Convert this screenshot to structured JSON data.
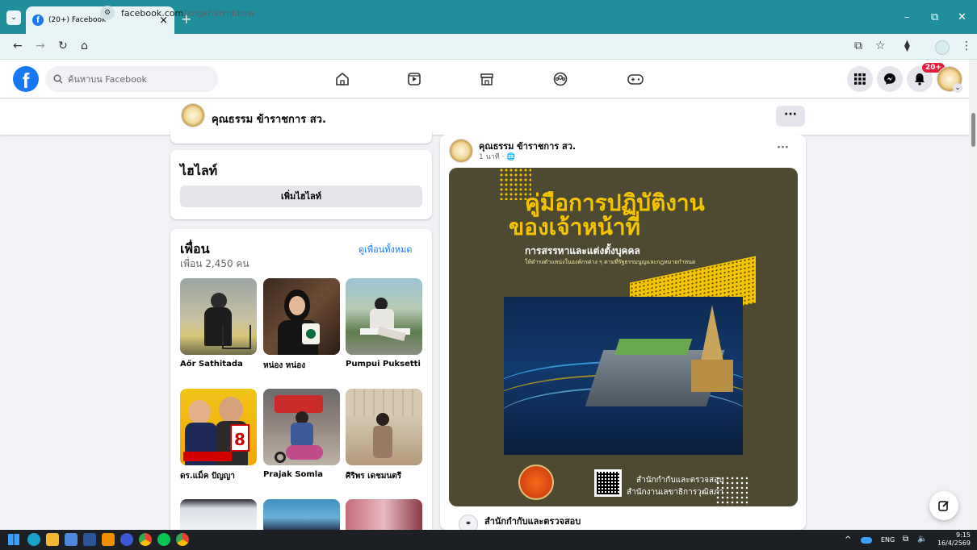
{
  "browser": {
    "tab_title": "(20+) Facebook",
    "close_tab": "×",
    "new_tab": "+",
    "url_host": "facebook.com",
    "url_path": "/xngkhkrtnbbsw",
    "window_minimize": "–",
    "window_restore": "⧉",
    "window_close": "✕"
  },
  "facebook": {
    "logo": "f",
    "search_placeholder": "ค้นหาบน Facebook",
    "notification_count": "20+"
  },
  "page_header": {
    "name": "คุณธรรม ข้าราชการ สว.",
    "more": "···"
  },
  "highlights": {
    "title": "ไฮไลท์",
    "add_button": "เพิ่มไฮไลท์"
  },
  "friends": {
    "title": "เพื่อน",
    "see_all": "ดูเพื่อนทั้งหมด",
    "count": "เพื่อน 2,450 คน",
    "items": [
      {
        "name": "Aőr Sathitada"
      },
      {
        "name": "หน่อง หน่อง"
      },
      {
        "name": "Pumpui Puksetti"
      },
      {
        "name": "ดร.แม็ค ปัญญา"
      },
      {
        "name": "Prajak Somla"
      },
      {
        "name": "ศิริพร เดชมนตรี"
      }
    ]
  },
  "post": {
    "author": "คุณธรรม ข้าราชการ สว.",
    "time": "1 นาที · 🌐",
    "more": "···",
    "image": {
      "title_line1": "คู่มือการปฏิบัติงาน",
      "title_line2": "ของเจ้าหน้าที่",
      "subtitle": "การสรรหาและแต่งตั้งบุคคล",
      "caption": "ให้ดำรงตำแหน่งในองค์กรต่าง ๆ ตามที่รัฐธรรมนูญและกฎหมายกำหนด",
      "org_line1": "สำนักกำกับและตรวจสอบ",
      "org_line2": "สำนักงานเลขาธิการวุฒิสภา"
    },
    "link_title": "สำนักกำกับและตรวจสอบ"
  },
  "taskbar": {
    "lang": "ENG",
    "time": "9:15",
    "date": "16/4/2569",
    "chevron": "^"
  },
  "colors": {
    "fb_blue": "#1877f2",
    "chrome_teal": "#1f8f9c",
    "poster_bg": "#4e4a31",
    "poster_yellow": "#f5c400"
  }
}
